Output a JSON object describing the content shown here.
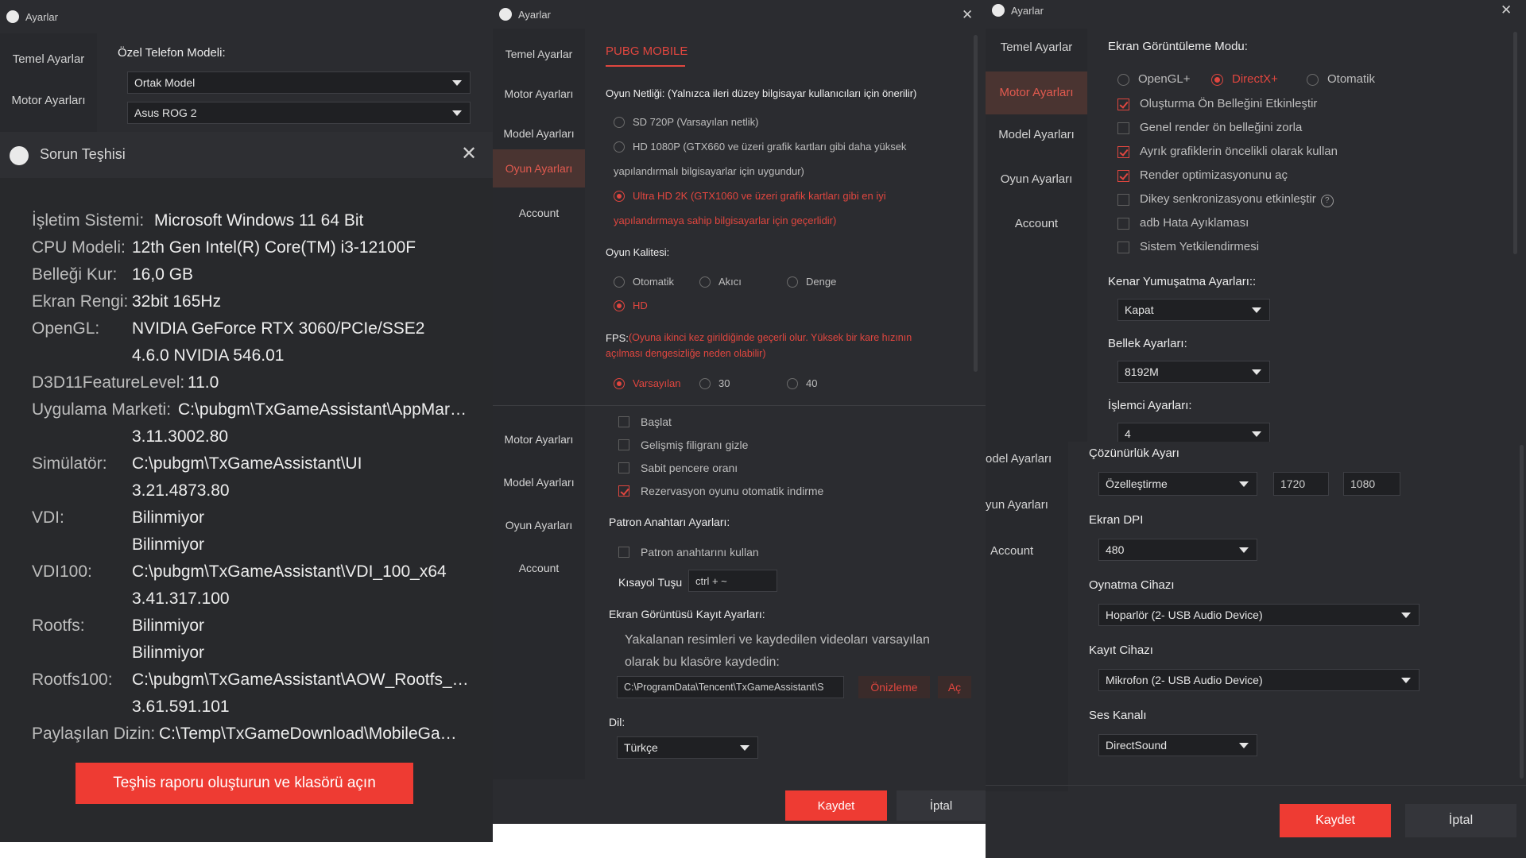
{
  "app_title": "Ayarlar",
  "panel1": {
    "nav": {
      "temel": "Temel Ayarlar",
      "motor": "Motor Ayarları"
    },
    "phone_model_label": "Özel Telefon Modeli:",
    "phone_model_value": "Ortak Model",
    "phone_value": "Asus ROG 2",
    "diag": {
      "title": "Sorun Teşhisi",
      "rows": {
        "os": {
          "label": "İşletim Sistemi:",
          "value": "Microsoft Windows 11 64 Bit"
        },
        "cpu": {
          "label": "CPU Modeli:",
          "value": "12th Gen Intel(R) Core(TM) i3-12100F"
        },
        "ram": {
          "label": "Belleği Kur:",
          "value": "16,0 GB"
        },
        "color": {
          "label": "Ekran Rengi:",
          "value": "32bit 165Hz"
        },
        "opengl": {
          "label": "OpenGL:",
          "value": "NVIDIA GeForce RTX 3060/PCIe/SSE2",
          "value2": "4.6.0 NVIDIA 546.01"
        },
        "d3d": {
          "label": "D3D11FeatureLevel:",
          "value": "11.0"
        },
        "market": {
          "label": "Uygulama Marketi:",
          "value": "C:\\pubgm\\TxGameAssistant\\AppMar…",
          "value2": "3.11.3002.80"
        },
        "sim": {
          "label": "Simülatör:",
          "value": "C:\\pubgm\\TxGameAssistant\\UI",
          "value2": "3.21.4873.80"
        },
        "vdi": {
          "label": "VDI:",
          "value": "Bilinmiyor",
          "value2": "Bilinmiyor"
        },
        "vdi100": {
          "label": "VDI100:",
          "value": "C:\\pubgm\\TxGameAssistant\\VDI_100_x64",
          "value2": "3.41.317.100"
        },
        "rootfs": {
          "label": "Rootfs:",
          "value": "Bilinmiyor",
          "value2": "Bilinmiyor"
        },
        "rootfs100": {
          "label": "Rootfs100:",
          "value": "C:\\pubgm\\TxGameAssistant\\AOW_Rootfs_…",
          "value2": "3.61.591.101"
        },
        "shared": {
          "label": "Paylaşılan Dizin:",
          "value": "C:\\Temp\\TxGameDownload\\MobileGa…"
        }
      },
      "button": "Teşhis raporu oluşturun ve klasörü açın"
    }
  },
  "panel2": {
    "nav": {
      "temel": "Temel Ayarlar",
      "motor": "Motor Ayarları",
      "model": "Model Ayarları",
      "oyun": "Oyun Ayarları",
      "account": "Account"
    },
    "tab": "PUBG MOBILE",
    "resolution_label": "Oyun Netliği: (Yalnızca ileri düzey bilgisayar kullanıcıları için önerilir)",
    "res": {
      "sd": "SD 720P (Varsayılan netlik)",
      "hd1": "HD 1080P (GTX660 ve üzeri grafik kartları gibi daha yüksek",
      "hd2": "yapılandırmalı bilgisayarlar için uygundur)",
      "uhd1": "Ultra HD 2K (GTX1060 ve üzeri grafik kartları gibi en iyi",
      "uhd2": "yapılandırmaya sahip bilgisayarlar için geçerlidir)"
    },
    "quality_label": "Oyun Kalitesi:",
    "quality": {
      "auto": "Otomatik",
      "smooth": "Akıcı",
      "balance": "Denge",
      "hd": "HD"
    },
    "fps_label": "FPS:",
    "fps_note1": "(Oyuna ikinci kez girildiğinde geçerli olur. Yüksek bir kare hızının",
    "fps_note2": "açılması dengesizliğe neden olabilir)",
    "fps": {
      "default": "Varsayılan",
      "f30": "30",
      "f40": "40"
    }
  },
  "panel3": {
    "nav": {
      "motor": "Motor Ayarları",
      "model": "Model Ayarları",
      "oyun": "Oyun Ayarları",
      "account": "Account"
    },
    "checks": {
      "start": "Başlat",
      "watermark": "Gelişmiş filigranı gizle",
      "fixed": "Sabit pencere oranı",
      "reserve": "Rezervasyon oyunu otomatik indirme"
    },
    "boss_label": "Patron Anahtarı Ayarları:",
    "boss_use": "Patron anahtarını kullan",
    "hotkey_label": "Kısayol Tuşu",
    "hotkey_value": "ctrl + ~",
    "capture_label": "Ekran Görüntüsü Kayıt Ayarları:",
    "capture_desc1": "Yakalanan resimleri ve kaydedilen videoları varsayılan",
    "capture_desc2": "olarak bu klasöre kaydedin:",
    "capture_path": "C:\\ProgramData\\Tencent\\TxGameAssistant\\S",
    "preview": "Önizleme",
    "open": "Aç",
    "lang_label": "Dil:",
    "lang_value": "Türkçe",
    "save": "Kaydet",
    "cancel": "İptal"
  },
  "panel4": {
    "nav": {
      "temel": "Temel Ayarlar",
      "motor": "Motor Ayarları",
      "model": "Model Ayarları",
      "oyun": "Oyun Ayarları",
      "account": "Account"
    },
    "render_label": "Ekran Görüntüleme Modu:",
    "render": {
      "opengl": "OpenGL+",
      "directx": "DirectX+",
      "auto": "Otomatik"
    },
    "checks": {
      "prebuffer": "Oluşturma Ön Belleğini Etkinleştir",
      "force": "Genel render ön belleğini zorla",
      "discrete": "Ayrık grafiklerin öncelikli olarak kullan",
      "optimize": "Render optimizasyonunu aç",
      "vsync": "Dikey senkronizasyonu etkinleştir",
      "adb": "adb Hata Ayıklaması",
      "sysauth": "Sistem Yetkilendirmesi"
    },
    "aa_label": "Kenar Yumuşatma Ayarları::",
    "aa_value": "Kapat",
    "mem_label": "Bellek Ayarları:",
    "mem_value": "8192M",
    "cpu_label": "İşlemci Ayarları:",
    "cpu_value": "4"
  },
  "panel5": {
    "nav": {
      "model": "odel Ayarları",
      "oyun": "yun Ayarları",
      "account": "Account"
    },
    "res_label": "Çözünürlük Ayarı",
    "res_value": "Özelleştirme",
    "res_w": "1720",
    "res_h": "1080",
    "dpi_label": "Ekran DPI",
    "dpi_value": "480",
    "play_label": "Oynatma Cihazı",
    "play_value": "Hoparlör (2- USB Audio Device)",
    "rec_label": "Kayıt Cihazı",
    "rec_value": "Mikrofon (2- USB Audio Device)",
    "ch_label": "Ses Kanalı",
    "ch_value": "DirectSound",
    "save": "Kaydet",
    "cancel": "İptal"
  }
}
